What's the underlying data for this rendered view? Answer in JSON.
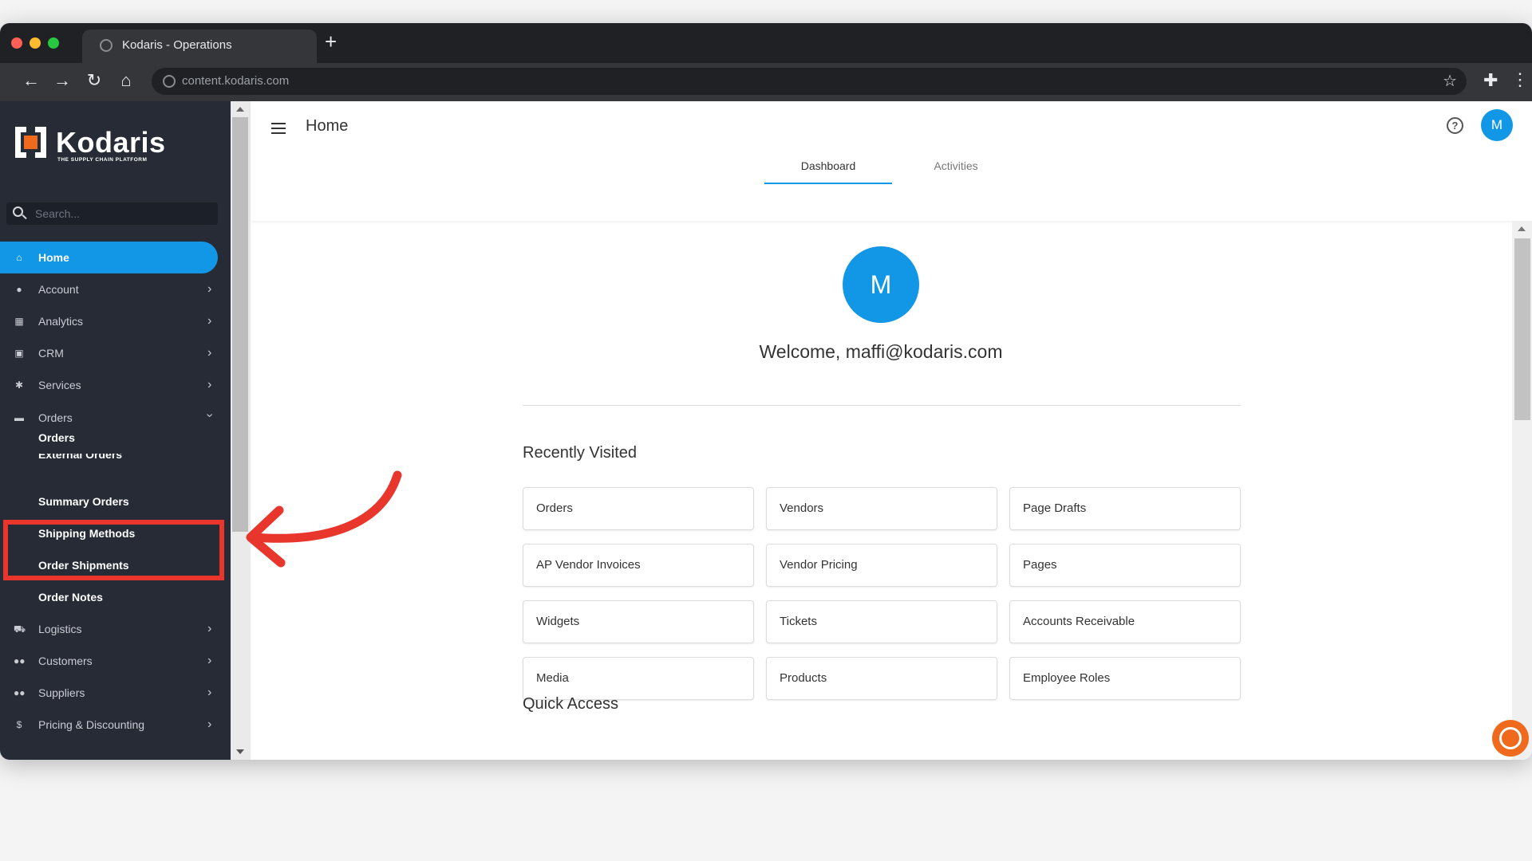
{
  "browser": {
    "tab_title": "Kodaris - Operations",
    "url": "content.kodaris.com",
    "traffic_lights": [
      "#ff5f57",
      "#febc2e",
      "#28c840"
    ]
  },
  "brand": {
    "name": "Kodaris",
    "tagline": "THE SUPPLY CHAIN PLATFORM",
    "accent": "#1297e6",
    "logo_orange": "#f06a1d"
  },
  "sidebar": {
    "search_placeholder": "Search...",
    "items": [
      {
        "label": "Home",
        "icon": "home-icon",
        "active": true
      },
      {
        "label": "Account",
        "icon": "person-icon",
        "chevron": true
      },
      {
        "label": "Analytics",
        "icon": "analytics-icon",
        "chevron": true
      },
      {
        "label": "CRM",
        "icon": "crm-icon",
        "chevron": true
      },
      {
        "label": "Services",
        "icon": "gears-icon",
        "chevron": true
      },
      {
        "label": "Orders",
        "icon": "truck-icon",
        "expanded": true
      }
    ],
    "sub_items": [
      "Orders",
      "External Orders",
      "Summary Orders",
      "Shipping Methods",
      "Order Shipments",
      "Order Notes"
    ],
    "items_after": [
      {
        "label": "Logistics",
        "icon": "logistics-icon"
      },
      {
        "label": "Customers",
        "icon": "people-icon"
      },
      {
        "label": "Suppliers",
        "icon": "people-icon"
      },
      {
        "label": "Pricing & Discounting",
        "icon": "dollar-icon"
      }
    ]
  },
  "header": {
    "title": "Home",
    "user_initial": "M"
  },
  "tabs": [
    {
      "label": "Dashboard",
      "active": true
    },
    {
      "label": "Activities",
      "active": false
    }
  ],
  "welcome": {
    "initial": "M",
    "text": "Welcome, maffi@kodaris.com"
  },
  "recently_visited": {
    "title": "Recently Visited",
    "tiles": [
      "Orders",
      "Vendors",
      "Page Drafts",
      "AP Vendor Invoices",
      "Vendor Pricing",
      "Pages",
      "Widgets",
      "Tickets",
      "Accounts Receivable",
      "Media",
      "Products",
      "Employee Roles"
    ]
  },
  "quick_access": {
    "title": "Quick Access"
  },
  "annotation": {
    "color": "#e8362d"
  }
}
